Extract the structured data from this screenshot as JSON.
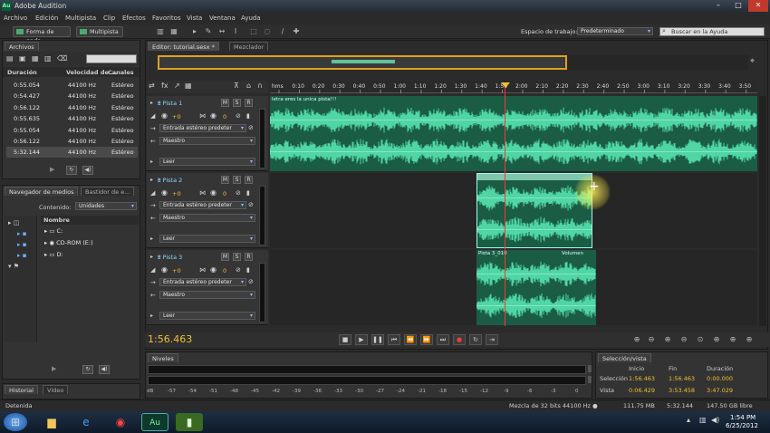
{
  "window": {
    "title": "Adobe Audition",
    "logo": "Au"
  },
  "menu": [
    "Archivo",
    "Edición",
    "Multipista",
    "Clip",
    "Efectos",
    "Favoritos",
    "Vista",
    "Ventana",
    "Ayuda"
  ],
  "toolbar": {
    "waveform_label": "Forma de onda",
    "multitrack_label": "Multipista",
    "workspace_label": "Espacio de trabajo:",
    "workspace_value": "Predeterminado",
    "search_placeholder": "Buscar en la Ayuda"
  },
  "files_panel": {
    "tab": "Archivos",
    "columns": [
      "Duración",
      "Velocidad de ...",
      "Canales"
    ],
    "rows": [
      {
        "duration": "0:55.054",
        "rate": "44100 Hz",
        "channels": "Estéreo"
      },
      {
        "duration": "0:54.427",
        "rate": "44100 Hz",
        "channels": "Estéreo"
      },
      {
        "duration": "0:56.122",
        "rate": "44100 Hz",
        "channels": "Estéreo"
      },
      {
        "duration": "0:55.635",
        "rate": "44100 Hz",
        "channels": "Estéreo"
      },
      {
        "duration": "0:55.054",
        "rate": "44100 Hz",
        "channels": "Estéreo"
      },
      {
        "duration": "0:56.122",
        "rate": "44100 Hz",
        "channels": "Estéreo"
      },
      {
        "duration": "5:32.144",
        "rate": "44100 Hz",
        "channels": "Estéreo"
      }
    ]
  },
  "media_panel": {
    "tabs": [
      "Navegador de medios",
      "Bastidor de e..."
    ],
    "content_label": "Contenido:",
    "content_value": "Unidades",
    "name_col": "Nombre",
    "drives": [
      "C:",
      "CD-ROM (E:)",
      "D:"
    ]
  },
  "history_panel": {
    "tabs": [
      "Historial",
      "Vídeo"
    ],
    "status": "Detenida"
  },
  "editor": {
    "tabs": [
      "Editor: tutorial.sesx *",
      "Mezclador"
    ],
    "ruler_labels": [
      "hms",
      "0:10",
      "0:20",
      "0:30",
      "0:40",
      "0:50",
      "1:00",
      "1:10",
      "1:20",
      "1:30",
      "1:40",
      "1:50",
      "2:00",
      "2:10",
      "2:20",
      "2:30",
      "2:40",
      "2:50",
      "3:00",
      "3:10",
      "3:20",
      "3:30",
      "3:40",
      "3:50"
    ],
    "tracks": [
      {
        "name": "Pista 1",
        "volume": "+0",
        "pan": "0",
        "input": "Entrada estéreo predeter",
        "output": "Maestro",
        "mode": "Leer",
        "clip_label": "letra eres la unica pista!!!"
      },
      {
        "name": "Pista 2",
        "volume": "+0",
        "pan": "0",
        "input": "Entrada estéreo predeter",
        "output": "Maestro",
        "mode": "Leer",
        "clip_label": ""
      },
      {
        "name": "Pista 3",
        "volume": "+0",
        "pan": "0",
        "input": "Entrada estéreo predeter",
        "output": "Maestro",
        "mode": "Leer",
        "clip_label": "Pista 3_010",
        "clip_param": "Volumen"
      }
    ],
    "msr": [
      "M",
      "S",
      "R"
    ],
    "time_display": "1:56.463"
  },
  "levels_panel": {
    "tab": "Niveles",
    "scale": [
      "dB",
      "-57",
      "-54",
      "-51",
      "-48",
      "-45",
      "-42",
      "-39",
      "-36",
      "-33",
      "-30",
      "-27",
      "-24",
      "-21",
      "-18",
      "-15",
      "-12",
      "-9",
      "-6",
      "-3",
      "0"
    ]
  },
  "selection_panel": {
    "tab": "Selección/vista",
    "headers": [
      "Inicio",
      "Fin",
      "Duración"
    ],
    "rows": [
      {
        "label": "Selección",
        "start": "1:56.463",
        "end": "1:56.463",
        "duration": "0:00.000"
      },
      {
        "label": "Vista",
        "start": "0:06.429",
        "end": "3:53.458",
        "duration": "3:47.029"
      }
    ]
  },
  "status_bar": {
    "mix": "Mezcla de 32 bits 44100 Hz ●",
    "memory": "111.75 MB",
    "duration": "5:32.144",
    "disk": "147.50 GB libre"
  },
  "taskbar": {
    "time": "1:54 PM",
    "date": "6/25/2012"
  },
  "colors": {
    "waveform": "#4fd6a4",
    "clip_bg": "#1b5c45",
    "playhead": "#e04040",
    "time_display": "#f0c030",
    "track_name": "#8fd6ff"
  }
}
